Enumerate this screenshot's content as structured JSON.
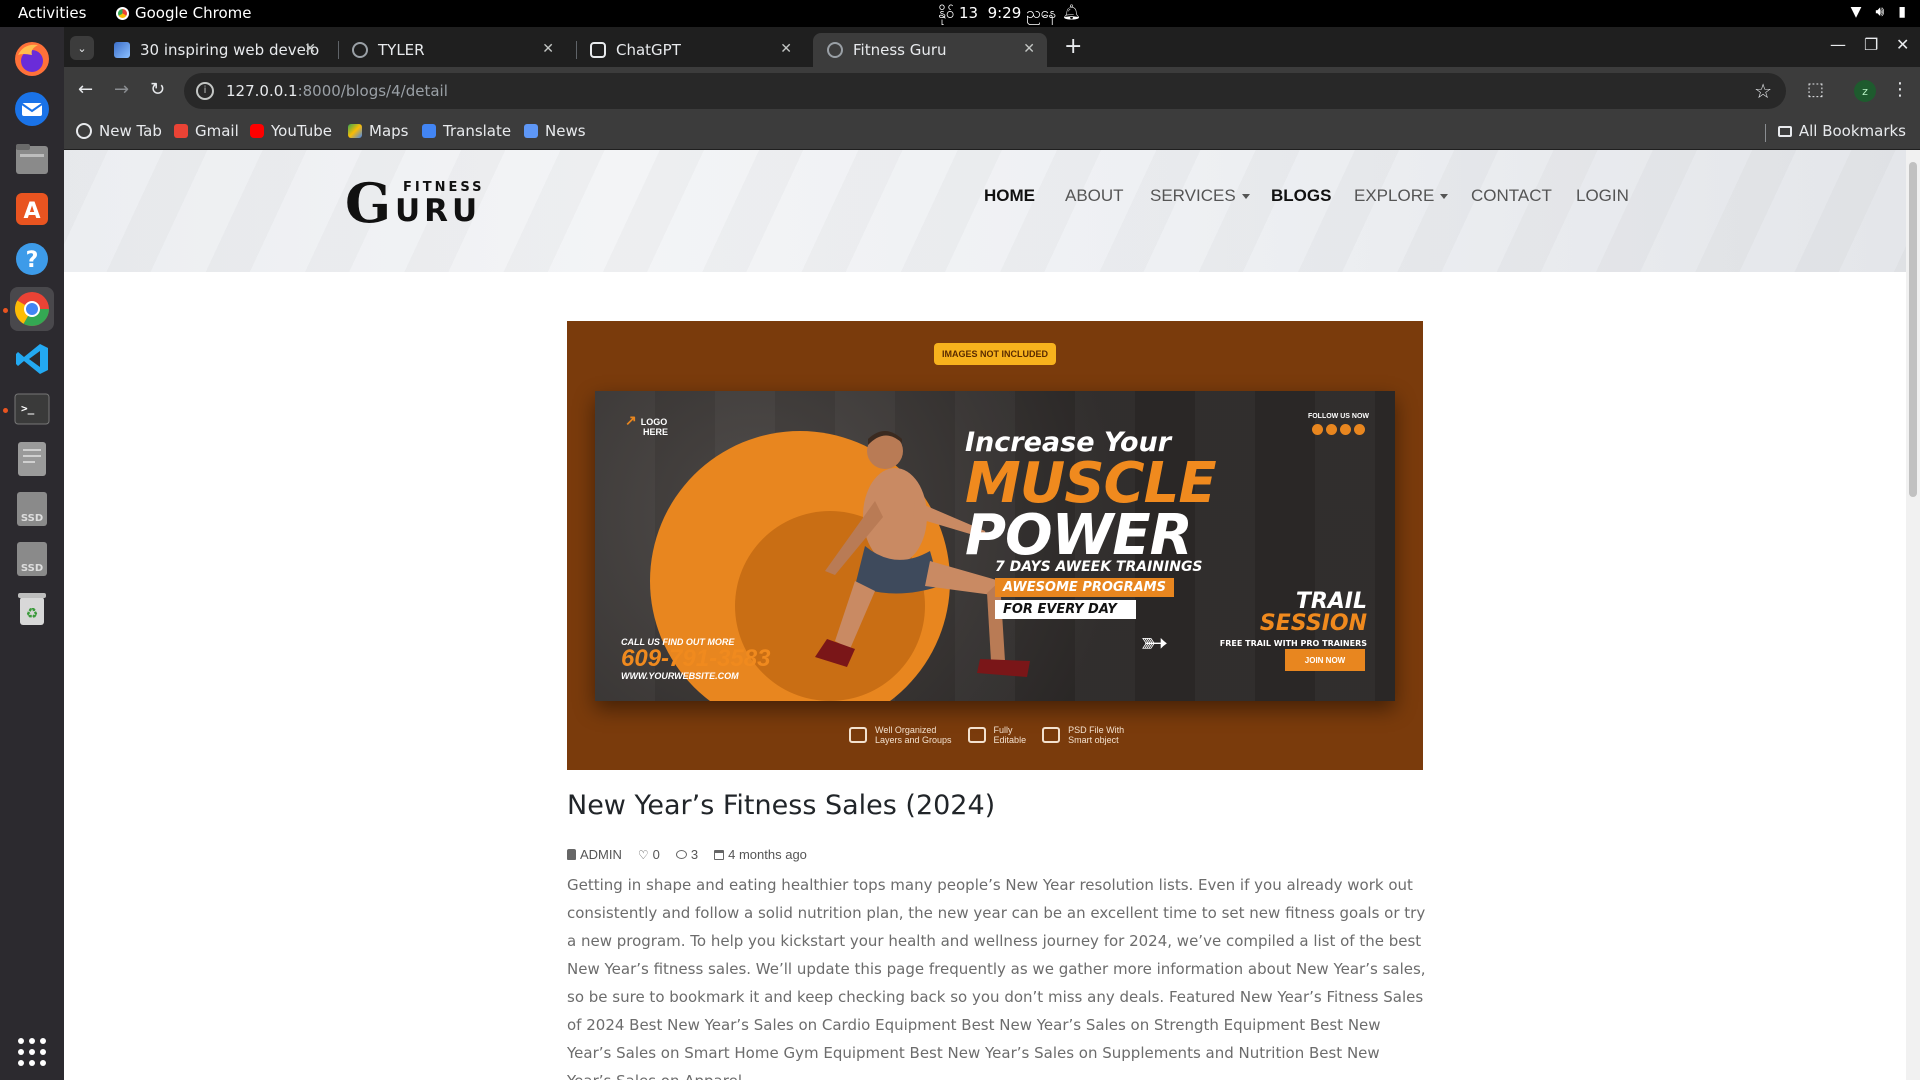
{
  "system": {
    "activities": "Activities",
    "app_name": "Google Chrome",
    "date": "နိုဝ် 13",
    "time": "9:29 ညနေ"
  },
  "dock": {
    "items": [
      "firefox",
      "thunderbird",
      "files",
      "app-center",
      "help",
      "chrome",
      "vscode",
      "terminal",
      "text-editor",
      "ssd-drive-1",
      "ssd-drive-2",
      "recycle-bin",
      "show-apps"
    ],
    "ssd_label": "SSD"
  },
  "tabs": [
    {
      "title": "30 inspiring web develo",
      "active": false
    },
    {
      "title": "TYLER",
      "active": false
    },
    {
      "title": "ChatGPT",
      "active": false
    },
    {
      "title": "Fitness Guru",
      "active": true
    }
  ],
  "address": {
    "host": "127.0.0.1",
    "path": ":8000/blogs/4/detail"
  },
  "profile_initial": "z",
  "bookmarks": [
    {
      "label": "New Tab"
    },
    {
      "label": "Gmail"
    },
    {
      "label": "YouTube"
    },
    {
      "label": "Maps"
    },
    {
      "label": "Translate"
    },
    {
      "label": "News"
    }
  ],
  "all_bookmarks": "All Bookmarks",
  "site": {
    "logo_big": "G",
    "logo_top": "FITNESS",
    "logo_bottom": "URU",
    "nav": [
      {
        "label": "HOME",
        "active": true
      },
      {
        "label": "ABOUT",
        "active": false
      },
      {
        "label": "SERVICES",
        "active": false,
        "dropdown": true
      },
      {
        "label": "BLOGS",
        "active": true
      },
      {
        "label": "EXPLORE",
        "active": false,
        "dropdown": true
      },
      {
        "label": "CONTACT",
        "active": false
      },
      {
        "label": "LOGIN",
        "active": false
      }
    ]
  },
  "banner": {
    "badge": "IMAGES NOT INCLUDED",
    "logo_here": [
      "LOGO",
      "HERE"
    ],
    "follow": "FOLLOW US NOW",
    "headline_1": "Increase Your",
    "headline_2": "MUSCLE",
    "headline_3": "POWER",
    "chip_1": "7 DAYS AWEEK TRAININGS",
    "chip_2": "AWESOME PROGRAMS",
    "chip_3": "FOR EVERY DAY",
    "trail_1": "TRAIL",
    "trail_2": "SESSION",
    "trail_3": "FREE TRAIL WITH PRO TRAINERS",
    "join": "JOIN NOW",
    "call_1": "CALL US FIND OUT MORE",
    "phone": "609-791-3583",
    "website": "WWW.YOURWEBSITE.COM",
    "features": [
      {
        "line1": "Well Organized",
        "line2": "Layers and Groups"
      },
      {
        "line1": "Fully",
        "line2": "Editable"
      },
      {
        "line1": "PSD File With",
        "line2": "Smart object"
      }
    ],
    "accent": "#e8861f",
    "background": "#7a3b0c"
  },
  "post": {
    "title": "New Year’s Fitness Sales (2024)",
    "author": "ADMIN",
    "likes": "0",
    "comments": "3",
    "date": "4 months ago",
    "body": "Getting in shape and eating healthier tops many people’s New Year resolution lists. Even if you already work out consistently and follow a solid nutrition plan, the new year can be an excellent time to set new fitness goals or try a new program. To help you kickstart your health and wellness journey for 2024, we’ve compiled a list of the best New Year’s fitness sales. We’ll update this page frequently as we gather more information about New Year’s sales, so be sure to bookmark it and keep checking back so you don’t miss any deals. Featured New Year’s Fitness Sales of 2024 Best New Year’s Sales on Cardio Equipment Best New Year’s Sales on Strength Equipment Best New Year’s Sales on Smart Home Gym Equipment Best New Year’s Sales on Supplements and Nutrition Best New Year’s Sales on Apparel"
  }
}
